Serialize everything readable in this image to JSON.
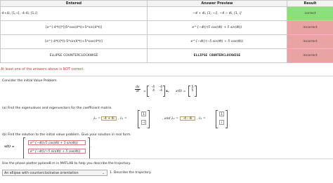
{
  "table": {
    "headers": {
      "entered": "Entered",
      "preview": "Answer Preview",
      "result": "Result"
    },
    "rows": [
      {
        "entered": "-4+4i, [1,-i], -4-4i, [1,i]",
        "preview": "−4 + 4i, [1, −i], −4 − 4i, [1, i]",
        "result": "correct"
      },
      {
        "entered": "[e^(-4*t)]*[(5*cos(4*t)+5*sin(4*t)]",
        "preview": "e^{−4t}(5 cos(4t) + 5 sin(4t))",
        "result": "incorrect"
      },
      {
        "entered": "[e^(-4*t)]*[(-5*sin(4*t)+5*cos(4*t)]",
        "preview": "e^{−4t}(−5 sin(4t) + 5 cos(4t))",
        "result": "incorrect"
      },
      {
        "entered": "ELLIPSE COUNTERCLOCKWISE",
        "preview": "ELLIPSE COUNTERCLOCKWISE",
        "result": "incorrect"
      }
    ]
  },
  "notice": "At least one of the answers above is NOT correct.",
  "problem": {
    "intro": "Consider the initial Value Problem",
    "dx": "dx",
    "dt": "dt",
    "matrix": [
      "-4",
      "-4",
      "4",
      "-4"
    ],
    "x_label": "x,",
    "x0_label": "x(0) =",
    "x0": [
      "5",
      "5"
    ],
    "part_a": "(a) Find the eigenvalues and eigenvectors for the coefficient matrix.",
    "lambda1_label": "λ₁ =",
    "lambda1": "-4 + 4i",
    "v1_label": ", v̄₁ =",
    "v1": [
      "1",
      "-i"
    ],
    "lambda2_label": ", and λ₂ =",
    "lambda2": "-4 - 4i",
    "v2_label": ", v̄₂ =",
    "v2": [
      "1",
      "i"
    ],
    "part_b": "(b) Find the solution to the initial value problem. Give your solution in real form.",
    "xt_label": "x(t) =",
    "sol1": "e^{−4t}(5 cos(4t) + 5 sin(4t))",
    "sol2": "e^{−4t}(−5 sin(4t) + 5 cos(4t))",
    "plotter_text": "Use the phase plotter pplane8.m in MATLAB to help you describe the trajectory.",
    "select_value": "An ellipse with counterclockwise orientation",
    "describe": "1. Describe the trajectory."
  }
}
